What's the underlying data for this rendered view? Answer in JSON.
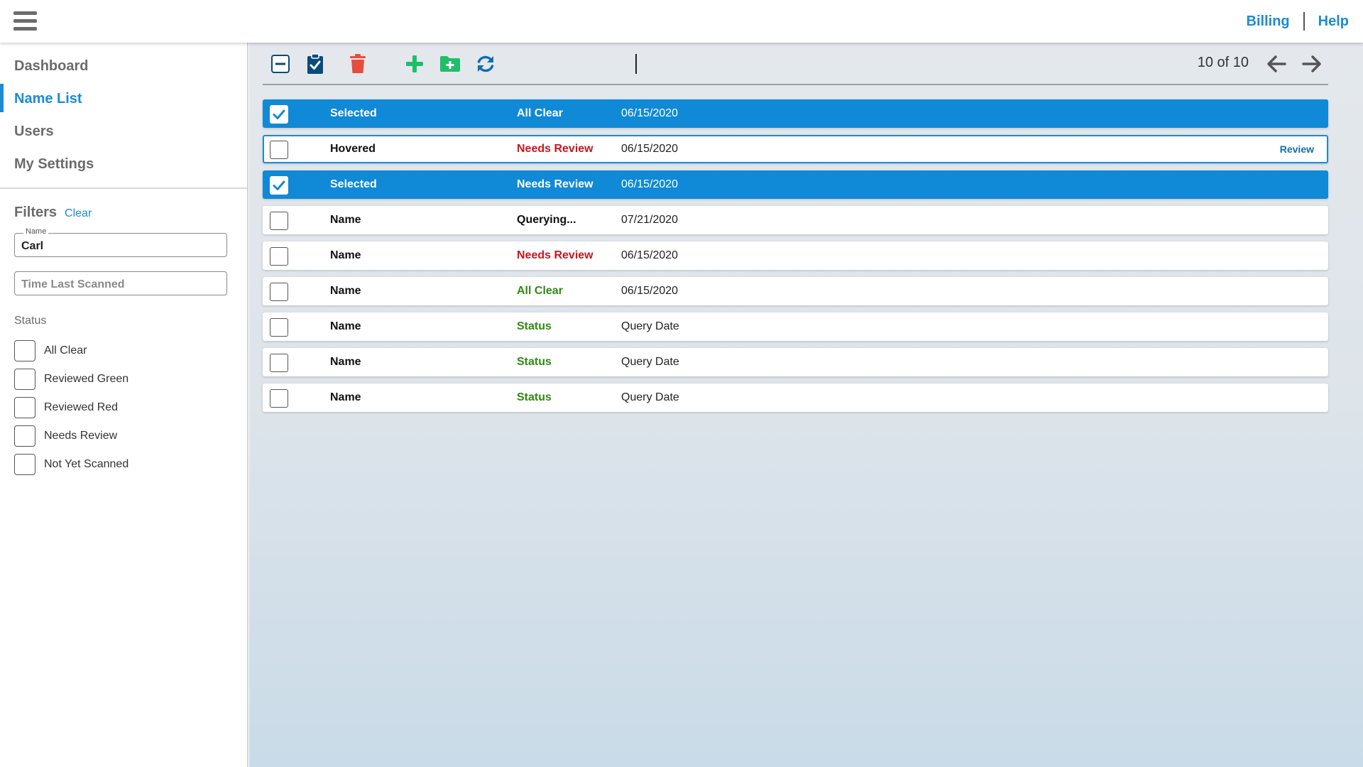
{
  "header": {
    "menu_icon": "hamburger-icon",
    "links": [
      "Billing",
      "Help"
    ]
  },
  "sidebar": {
    "nav": [
      {
        "label": "Dashboard",
        "active": false
      },
      {
        "label": "Name List",
        "active": true
      },
      {
        "label": "Users",
        "active": false
      },
      {
        "label": "My Settings",
        "active": false
      }
    ],
    "filters": {
      "title": "Filters",
      "clear_label": "Clear",
      "name_field": {
        "legend": "Name",
        "value": "Carl"
      },
      "time_field": {
        "placeholder": "Time Last Scanned",
        "value": ""
      },
      "status_title": "Status",
      "status_options": [
        "All Clear",
        "Reviewed Green",
        "Reviewed Red",
        "Needs Review",
        "Not Yet Scanned"
      ]
    }
  },
  "toolbar": {
    "icons": [
      "deselect-all-icon",
      "clipboard-check-icon",
      "trash-icon",
      "plus-icon",
      "folder-plus-icon",
      "refresh-icon"
    ],
    "count": "10 of 10",
    "prev_icon": "arrow-left-icon",
    "next_icon": "arrow-right-icon"
  },
  "colors": {
    "accent": "#1b8bd6",
    "selected_row": "#1089d6",
    "status_red": "#c8161d",
    "status_green": "#2e8b12",
    "delete_red": "#e74c3c",
    "add_green": "#1fbf6a",
    "dark_blue": "#0b4a7d"
  },
  "rows": [
    {
      "name": "Selected",
      "status": "All Clear",
      "status_color": "white",
      "date": "06/15/2020",
      "state": "selected",
      "checked": true
    },
    {
      "name": "Hovered",
      "status": "Needs Review",
      "status_color": "red",
      "date": "06/15/2020",
      "state": "hovered",
      "checked": false,
      "action": "Review"
    },
    {
      "name": "Selected",
      "status": "Needs Review",
      "status_color": "white",
      "date": "06/15/2020",
      "state": "selected",
      "checked": true
    },
    {
      "name": "Name",
      "status": "Querying...",
      "status_color": "black",
      "date": "07/21/2020",
      "state": "normal",
      "checked": false
    },
    {
      "name": "Name",
      "status": "Needs Review",
      "status_color": "red",
      "date": "06/15/2020",
      "state": "normal",
      "checked": false
    },
    {
      "name": "Name",
      "status": "All Clear",
      "status_color": "green",
      "date": "06/15/2020",
      "state": "normal",
      "checked": false
    },
    {
      "name": "Name",
      "status": "Status",
      "status_color": "green",
      "date": "Query Date",
      "state": "normal",
      "checked": false
    },
    {
      "name": "Name",
      "status": "Status",
      "status_color": "green",
      "date": "Query Date",
      "state": "normal",
      "checked": false
    },
    {
      "name": "Name",
      "status": "Status",
      "status_color": "green",
      "date": "Query Date",
      "state": "normal",
      "checked": false
    }
  ]
}
